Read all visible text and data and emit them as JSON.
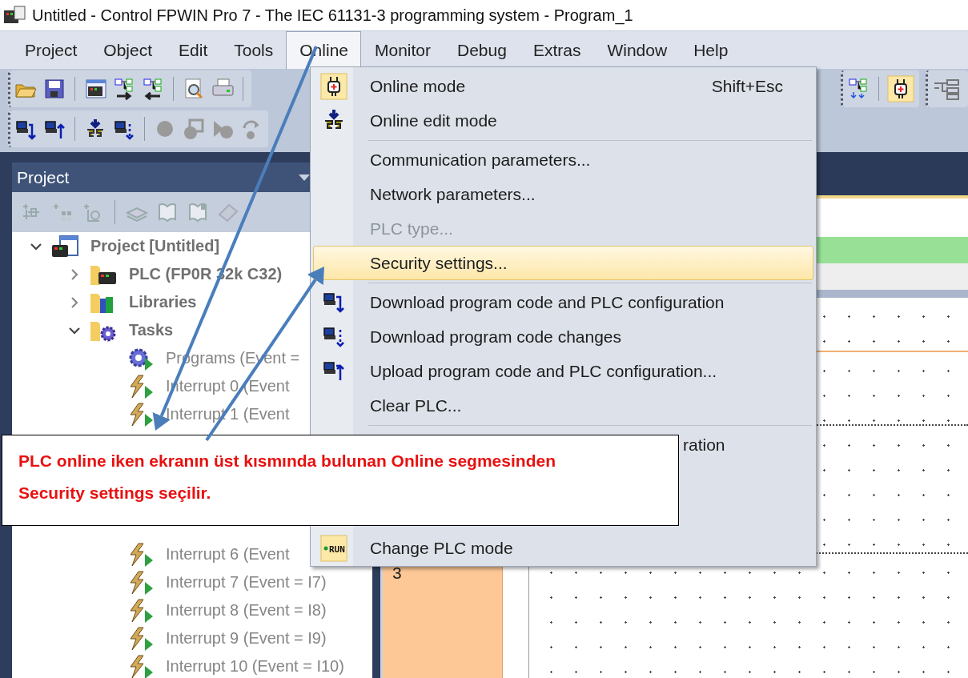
{
  "window": {
    "title": "Untitled - Control FPWIN Pro 7 - The IEC 61131-3 programming system - Program_1"
  },
  "menubar": [
    {
      "label": "Project",
      "selected": false
    },
    {
      "label": "Object",
      "selected": false
    },
    {
      "label": "Edit",
      "selected": false
    },
    {
      "label": "Tools",
      "selected": false
    },
    {
      "label": "Online",
      "selected": true
    },
    {
      "label": "Monitor",
      "selected": false
    },
    {
      "label": "Debug",
      "selected": false
    },
    {
      "label": "Extras",
      "selected": false
    },
    {
      "label": "Window",
      "selected": false
    },
    {
      "label": "Help",
      "selected": false
    }
  ],
  "project_panel": {
    "title": "Project",
    "tree": [
      {
        "label": "Project [Untitled]",
        "kind": "project",
        "expanded": true,
        "children": [
          {
            "label": "PLC (FP0R 32k C32)",
            "kind": "plc",
            "expanded": false
          },
          {
            "label": "Libraries",
            "kind": "libraries",
            "expanded": false
          },
          {
            "label": "Tasks",
            "kind": "tasks",
            "expanded": true,
            "children": [
              {
                "label": "Programs (Event =",
                "kind": "program"
              },
              {
                "label": "Interrupt 0 (Event",
                "kind": "interrupt"
              },
              {
                "label": "Interrupt 1 (Event",
                "kind": "interrupt"
              },
              {
                "label": "Interrupt 6 (Event",
                "kind": "interrupt"
              },
              {
                "label": "Interrupt 7 (Event = I7)",
                "kind": "interrupt"
              },
              {
                "label": "Interrupt 8 (Event = I8)",
                "kind": "interrupt"
              },
              {
                "label": "Interrupt 9 (Event = I9)",
                "kind": "interrupt"
              },
              {
                "label": "Interrupt 10 (Event = I10)",
                "kind": "interrupt"
              }
            ]
          }
        ]
      }
    ]
  },
  "editor": {
    "networks": [
      {
        "number": "3"
      }
    ]
  },
  "online_menu": {
    "items": [
      {
        "kind": "item",
        "label": "Online mode",
        "shortcut": "Shift+Esc",
        "checked": true,
        "disabled": false,
        "highlighted": false
      },
      {
        "kind": "item",
        "label": "Online edit mode",
        "checked": false,
        "disabled": false,
        "highlighted": false
      },
      {
        "kind": "separator"
      },
      {
        "kind": "item",
        "label": "Communication parameters...",
        "checked": false,
        "disabled": false,
        "highlighted": false
      },
      {
        "kind": "item",
        "label": "Network parameters...",
        "checked": false,
        "disabled": false,
        "highlighted": false
      },
      {
        "kind": "item",
        "label": "PLC type...",
        "checked": false,
        "disabled": true,
        "highlighted": false
      },
      {
        "kind": "item",
        "label": "Security settings...",
        "checked": false,
        "disabled": false,
        "highlighted": true
      },
      {
        "kind": "separator"
      },
      {
        "kind": "item",
        "label": "Download program code and PLC configuration",
        "checked": false,
        "disabled": false,
        "highlighted": false
      },
      {
        "kind": "item",
        "label": "Download program code changes",
        "checked": false,
        "disabled": false,
        "highlighted": false
      },
      {
        "kind": "item",
        "label": "Upload program code and PLC configuration...",
        "checked": false,
        "disabled": false,
        "highlighted": false
      },
      {
        "kind": "item",
        "label": "Clear PLC...",
        "checked": false,
        "disabled": false,
        "highlighted": false
      },
      {
        "kind": "separator"
      },
      {
        "kind": "partial",
        "label": "ration",
        "checked": false,
        "disabled": false,
        "highlighted": false
      },
      {
        "kind": "item",
        "label": "Change PLC mode",
        "icon_text": "RUN",
        "checked": true,
        "disabled": false,
        "highlighted": false
      }
    ]
  },
  "annotation": {
    "text": "PLC online iken ekranın üst kısmında bulunan Online segmesinden Security settings seçilir."
  }
}
